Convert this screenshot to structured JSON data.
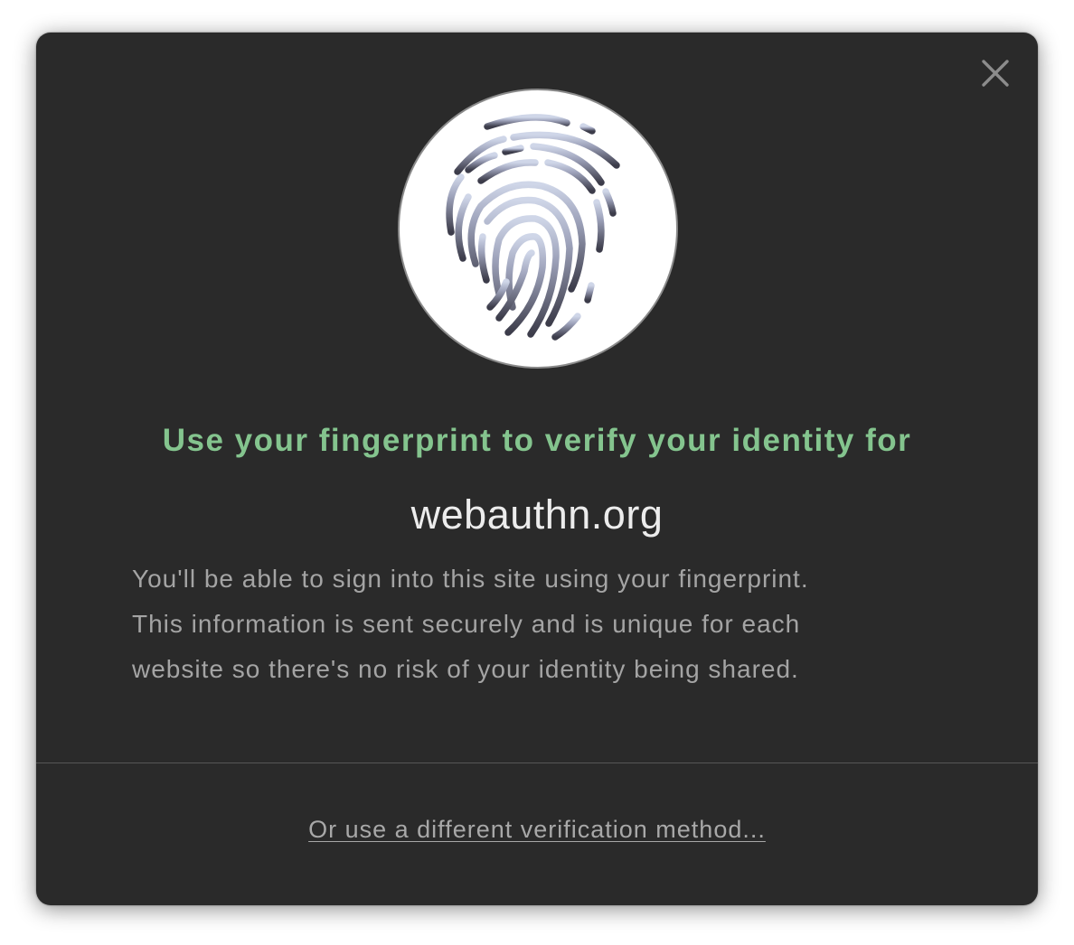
{
  "dialog": {
    "close_icon": "close-icon",
    "fingerprint_icon": "fingerprint-icon",
    "headline": "Use your fingerprint to verify your identity for",
    "site": "webauthn.org",
    "description_lines": [
      "You'll be able to sign into this site using your fingerprint.",
      "This information is sent securely and is unique for each",
      "website so there's no risk of your identity being shared."
    ],
    "alternate_link": "Or use a different verification method..."
  },
  "colors": {
    "dialog_background": "#2a2a2a",
    "headline": "#84c48e",
    "site_text": "#ececec",
    "body_text": "#a4a4a4",
    "link_text": "#a8a8a8",
    "divider": "#575757"
  }
}
